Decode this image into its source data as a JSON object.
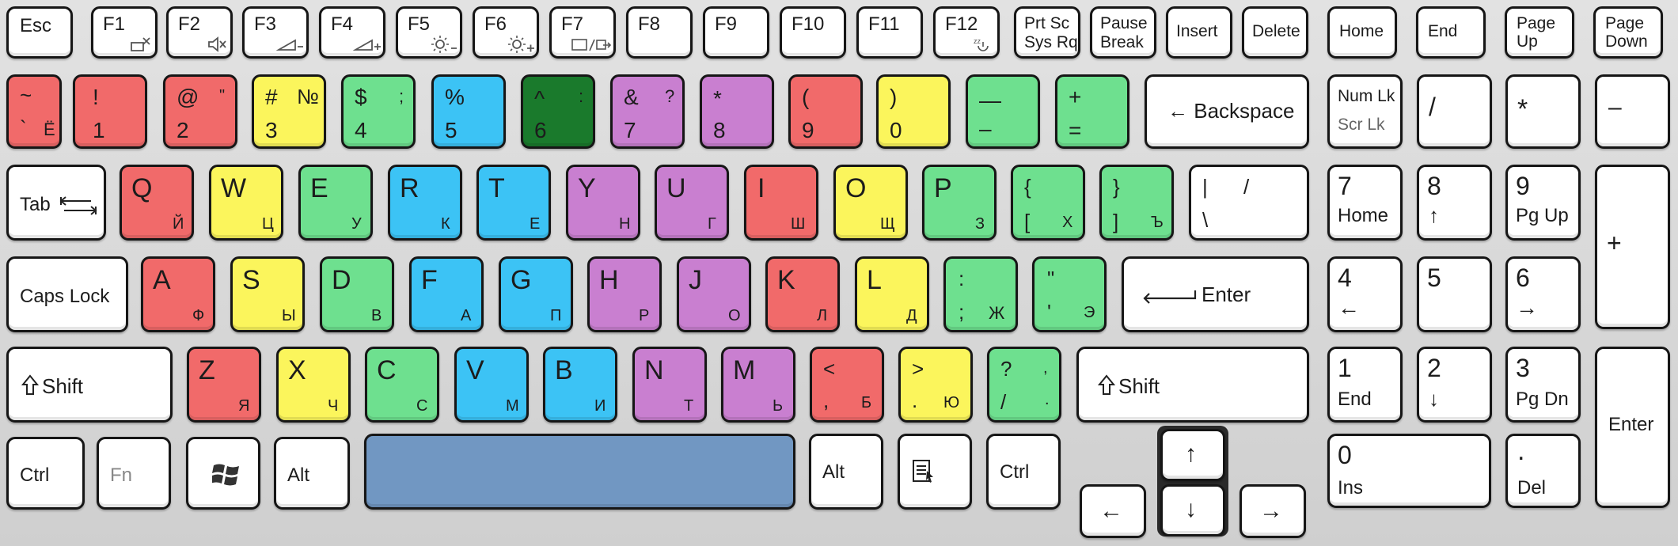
{
  "colors": {
    "red": "#f16a6a",
    "yellow": "#fbf55c",
    "green": "#6ee08f",
    "blue": "#3cc3f5",
    "purple": "#c97fd0",
    "dark_green": "#1a7a2c",
    "space": "#7197c2",
    "white": "#ffffff"
  },
  "row0": {
    "esc": "Esc",
    "f1": {
      "label": "F1",
      "icon": "display-off-icon"
    },
    "f2": {
      "label": "F2",
      "icon": "mute-icon"
    },
    "f3": {
      "label": "F3",
      "icon": "volume-down-icon"
    },
    "f4": {
      "label": "F4",
      "icon": "volume-up-icon"
    },
    "f5": {
      "label": "F5",
      "icon": "brightness-down-icon"
    },
    "f6": {
      "label": "F6",
      "icon": "brightness-up-icon"
    },
    "f7": {
      "label": "F7",
      "icon": "display-switch-icon"
    },
    "f8": "F8",
    "f9": "F9",
    "f10": "F10",
    "f11": "F11",
    "f12": {
      "label": "F12",
      "icon": "sleep-icon"
    },
    "prtsc": [
      "Prt Sc",
      "Sys Rq"
    ],
    "pause": [
      "Pause",
      "Break"
    ],
    "insert": "Insert",
    "delete": "Delete",
    "home": "Home",
    "end": "End",
    "pgup": [
      "Page",
      "Up"
    ],
    "pgdn": [
      "Page",
      "Down"
    ]
  },
  "row1": {
    "tilde": [
      "~",
      "`",
      "Ё"
    ],
    "k1": [
      "!",
      "1"
    ],
    "k2": [
      "@",
      "\"",
      "2"
    ],
    "k3": [
      "#",
      "№",
      "3"
    ],
    "k4": [
      "$",
      ";",
      "4"
    ],
    "k5": [
      "%",
      "5"
    ],
    "k6": [
      "^",
      ":",
      "6"
    ],
    "k7": [
      "&",
      "?",
      "7"
    ],
    "k8": [
      "*",
      "8"
    ],
    "k9": [
      "(",
      "9"
    ],
    "k0": [
      ")",
      "0"
    ],
    "minus": [
      "—",
      "–"
    ],
    "equal": [
      "+",
      "="
    ],
    "backspace": "← Backspace",
    "numlk": [
      "Num Lk",
      "Scr Lk"
    ],
    "div": "/",
    "mul": "*",
    "sub": "–"
  },
  "row2": {
    "tab": "Tab",
    "q": [
      "Q",
      "Й"
    ],
    "w": [
      "W",
      "Ц"
    ],
    "e": [
      "E",
      "У"
    ],
    "r": [
      "R",
      "К"
    ],
    "t": [
      "T",
      "Е"
    ],
    "y": [
      "Y",
      "Н"
    ],
    "u": [
      "U",
      "Г"
    ],
    "i": [
      "I",
      "Ш"
    ],
    "o": [
      "O",
      "Щ"
    ],
    "p": [
      "P",
      "З"
    ],
    "lbr": [
      "{",
      "[",
      "Х"
    ],
    "rbr": [
      "}",
      "]",
      "Ъ"
    ],
    "bslash": [
      "|",
      "/",
      "\\"
    ],
    "n7": [
      "7",
      "Home"
    ],
    "n8": [
      "8",
      "↑"
    ],
    "n9": [
      "9",
      "Pg Up"
    ],
    "plus": "+"
  },
  "row3": {
    "caps": "Caps Lock",
    "a": [
      "A",
      "Ф"
    ],
    "s": [
      "S",
      "Ы"
    ],
    "d": [
      "D",
      "В"
    ],
    "f": [
      "F",
      "А"
    ],
    "g": [
      "G",
      "П"
    ],
    "h": [
      "H",
      "Р"
    ],
    "j": [
      "J",
      "О"
    ],
    "k": [
      "K",
      "Л"
    ],
    "l": [
      "L",
      "Д"
    ],
    "semi": [
      ":",
      ";",
      "Ж"
    ],
    "quote": [
      "\"",
      "'",
      "Э"
    ],
    "enter": "Enter",
    "n4": [
      "4",
      "←"
    ],
    "n5": "5",
    "n6": [
      "6",
      "→"
    ]
  },
  "row4": {
    "lshift": "Shift",
    "z": [
      "Z",
      "Я"
    ],
    "x": [
      "X",
      "Ч"
    ],
    "c": [
      "C",
      "С"
    ],
    "v": [
      "V",
      "М"
    ],
    "b": [
      "B",
      "И"
    ],
    "n": [
      "N",
      "Т"
    ],
    "m": [
      "M",
      "Ь"
    ],
    "comma": [
      "<",
      ",",
      "Б"
    ],
    "period": [
      ">",
      ".",
      "Ю"
    ],
    "slash": [
      "?",
      ",",
      "/",
      "."
    ],
    "rshift": "Shift",
    "n1": [
      "1",
      "End"
    ],
    "n2": [
      "2",
      "↓"
    ],
    "n3": [
      "3",
      "Pg Dn"
    ],
    "npenter": "Enter"
  },
  "row5": {
    "ctrl": "Ctrl",
    "fn": "Fn",
    "win": "windows-logo-icon",
    "alt": "Alt",
    "space": "",
    "altr": "Alt",
    "menu": "context-menu-icon",
    "ctrlr": "Ctrl",
    "up": "↑",
    "left": "←",
    "down": "↓",
    "right": "→",
    "n0": [
      "0",
      "Ins"
    ],
    "ndel": [
      ".",
      "Del"
    ]
  }
}
